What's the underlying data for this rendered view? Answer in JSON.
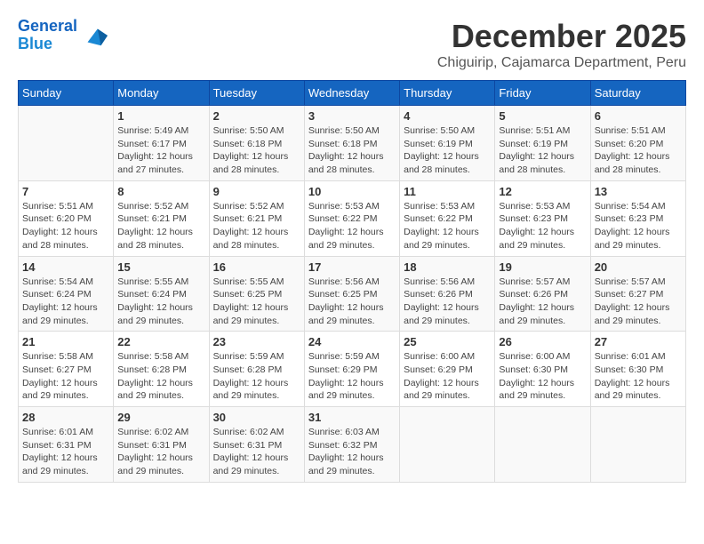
{
  "header": {
    "logo_line1": "General",
    "logo_line2": "Blue",
    "month_title": "December 2025",
    "location": "Chiguirip, Cajamarca Department, Peru"
  },
  "days_of_week": [
    "Sunday",
    "Monday",
    "Tuesday",
    "Wednesday",
    "Thursday",
    "Friday",
    "Saturday"
  ],
  "weeks": [
    [
      {
        "day": "",
        "info": ""
      },
      {
        "day": "1",
        "info": "Sunrise: 5:49 AM\nSunset: 6:17 PM\nDaylight: 12 hours\nand 27 minutes."
      },
      {
        "day": "2",
        "info": "Sunrise: 5:50 AM\nSunset: 6:18 PM\nDaylight: 12 hours\nand 28 minutes."
      },
      {
        "day": "3",
        "info": "Sunrise: 5:50 AM\nSunset: 6:18 PM\nDaylight: 12 hours\nand 28 minutes."
      },
      {
        "day": "4",
        "info": "Sunrise: 5:50 AM\nSunset: 6:19 PM\nDaylight: 12 hours\nand 28 minutes."
      },
      {
        "day": "5",
        "info": "Sunrise: 5:51 AM\nSunset: 6:19 PM\nDaylight: 12 hours\nand 28 minutes."
      },
      {
        "day": "6",
        "info": "Sunrise: 5:51 AM\nSunset: 6:20 PM\nDaylight: 12 hours\nand 28 minutes."
      }
    ],
    [
      {
        "day": "7",
        "info": "Sunrise: 5:51 AM\nSunset: 6:20 PM\nDaylight: 12 hours\nand 28 minutes."
      },
      {
        "day": "8",
        "info": "Sunrise: 5:52 AM\nSunset: 6:21 PM\nDaylight: 12 hours\nand 28 minutes."
      },
      {
        "day": "9",
        "info": "Sunrise: 5:52 AM\nSunset: 6:21 PM\nDaylight: 12 hours\nand 28 minutes."
      },
      {
        "day": "10",
        "info": "Sunrise: 5:53 AM\nSunset: 6:22 PM\nDaylight: 12 hours\nand 29 minutes."
      },
      {
        "day": "11",
        "info": "Sunrise: 5:53 AM\nSunset: 6:22 PM\nDaylight: 12 hours\nand 29 minutes."
      },
      {
        "day": "12",
        "info": "Sunrise: 5:53 AM\nSunset: 6:23 PM\nDaylight: 12 hours\nand 29 minutes."
      },
      {
        "day": "13",
        "info": "Sunrise: 5:54 AM\nSunset: 6:23 PM\nDaylight: 12 hours\nand 29 minutes."
      }
    ],
    [
      {
        "day": "14",
        "info": "Sunrise: 5:54 AM\nSunset: 6:24 PM\nDaylight: 12 hours\nand 29 minutes."
      },
      {
        "day": "15",
        "info": "Sunrise: 5:55 AM\nSunset: 6:24 PM\nDaylight: 12 hours\nand 29 minutes."
      },
      {
        "day": "16",
        "info": "Sunrise: 5:55 AM\nSunset: 6:25 PM\nDaylight: 12 hours\nand 29 minutes."
      },
      {
        "day": "17",
        "info": "Sunrise: 5:56 AM\nSunset: 6:25 PM\nDaylight: 12 hours\nand 29 minutes."
      },
      {
        "day": "18",
        "info": "Sunrise: 5:56 AM\nSunset: 6:26 PM\nDaylight: 12 hours\nand 29 minutes."
      },
      {
        "day": "19",
        "info": "Sunrise: 5:57 AM\nSunset: 6:26 PM\nDaylight: 12 hours\nand 29 minutes."
      },
      {
        "day": "20",
        "info": "Sunrise: 5:57 AM\nSunset: 6:27 PM\nDaylight: 12 hours\nand 29 minutes."
      }
    ],
    [
      {
        "day": "21",
        "info": "Sunrise: 5:58 AM\nSunset: 6:27 PM\nDaylight: 12 hours\nand 29 minutes."
      },
      {
        "day": "22",
        "info": "Sunrise: 5:58 AM\nSunset: 6:28 PM\nDaylight: 12 hours\nand 29 minutes."
      },
      {
        "day": "23",
        "info": "Sunrise: 5:59 AM\nSunset: 6:28 PM\nDaylight: 12 hours\nand 29 minutes."
      },
      {
        "day": "24",
        "info": "Sunrise: 5:59 AM\nSunset: 6:29 PM\nDaylight: 12 hours\nand 29 minutes."
      },
      {
        "day": "25",
        "info": "Sunrise: 6:00 AM\nSunset: 6:29 PM\nDaylight: 12 hours\nand 29 minutes."
      },
      {
        "day": "26",
        "info": "Sunrise: 6:00 AM\nSunset: 6:30 PM\nDaylight: 12 hours\nand 29 minutes."
      },
      {
        "day": "27",
        "info": "Sunrise: 6:01 AM\nSunset: 6:30 PM\nDaylight: 12 hours\nand 29 minutes."
      }
    ],
    [
      {
        "day": "28",
        "info": "Sunrise: 6:01 AM\nSunset: 6:31 PM\nDaylight: 12 hours\nand 29 minutes."
      },
      {
        "day": "29",
        "info": "Sunrise: 6:02 AM\nSunset: 6:31 PM\nDaylight: 12 hours\nand 29 minutes."
      },
      {
        "day": "30",
        "info": "Sunrise: 6:02 AM\nSunset: 6:31 PM\nDaylight: 12 hours\nand 29 minutes."
      },
      {
        "day": "31",
        "info": "Sunrise: 6:03 AM\nSunset: 6:32 PM\nDaylight: 12 hours\nand 29 minutes."
      },
      {
        "day": "",
        "info": ""
      },
      {
        "day": "",
        "info": ""
      },
      {
        "day": "",
        "info": ""
      }
    ]
  ]
}
